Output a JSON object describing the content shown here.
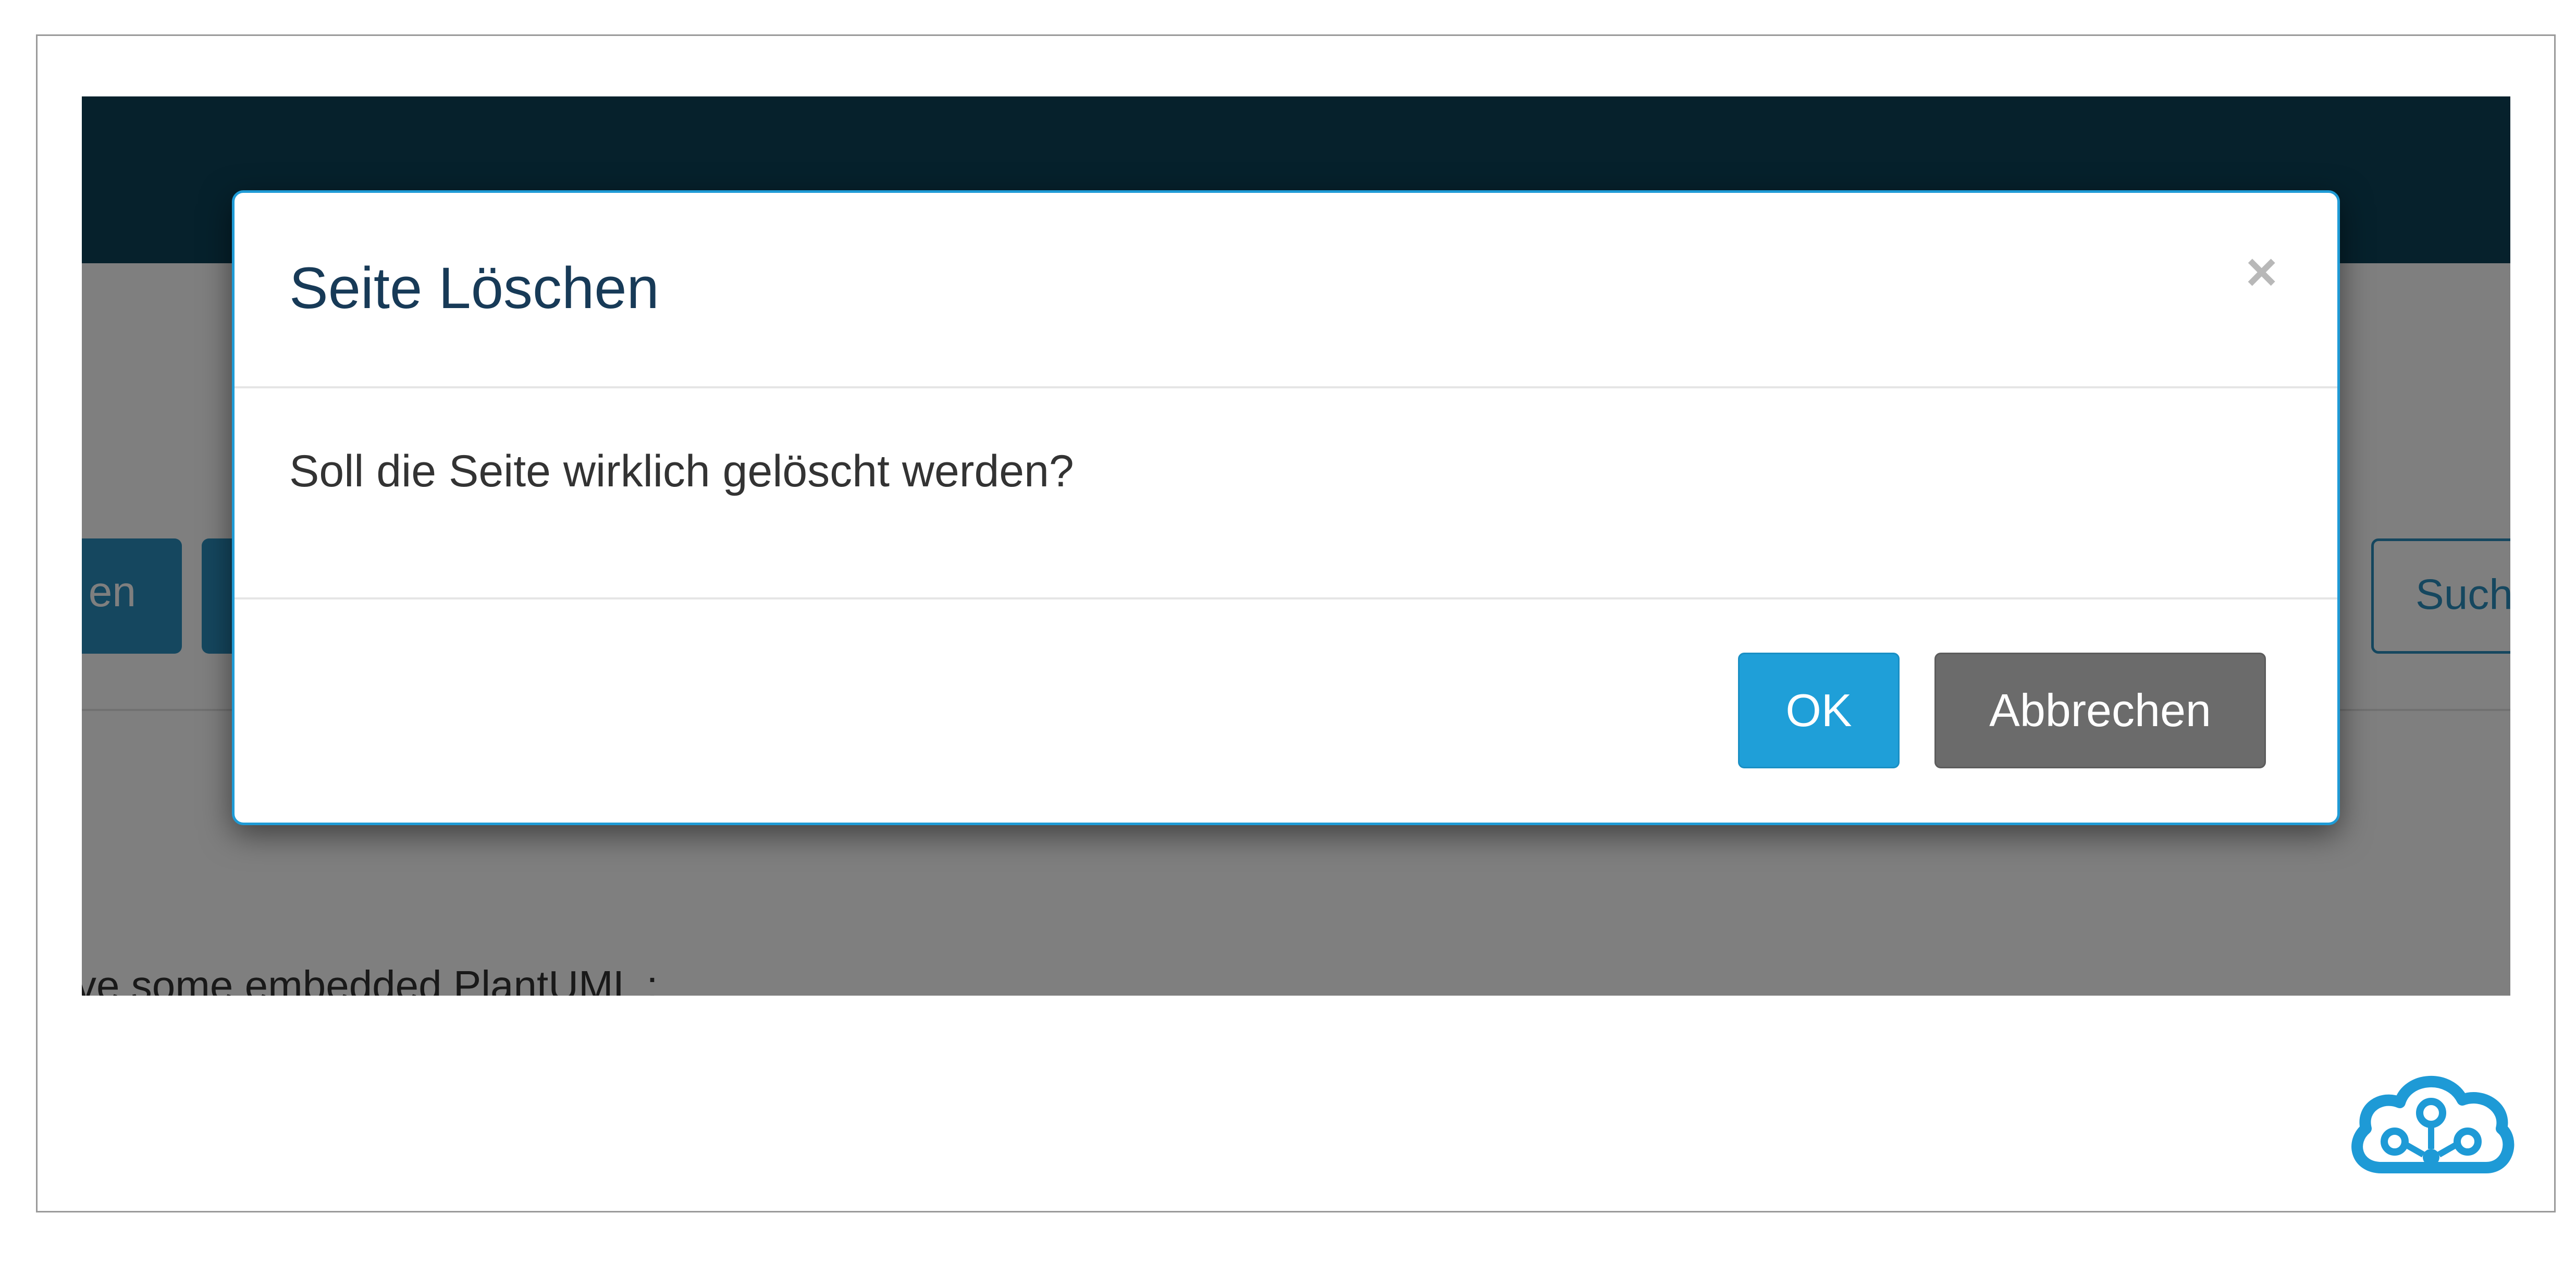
{
  "background": {
    "left_button_label": "en",
    "search_button_label": "Such",
    "body_text": "ve some embedded PlantUML :"
  },
  "modal": {
    "title": "Seite Löschen",
    "close_symbol": "×",
    "message": "Soll die Seite wirklich gelöscht werden?",
    "ok_label": "OK",
    "cancel_label": "Abbrechen"
  },
  "colors": {
    "header": "#0d4358",
    "primary": "#1f9fd8",
    "secondary": "#6b6b6b",
    "modal_border": "#1f9bd6"
  },
  "icons": {
    "corner_logo": "cloud-network-icon"
  }
}
